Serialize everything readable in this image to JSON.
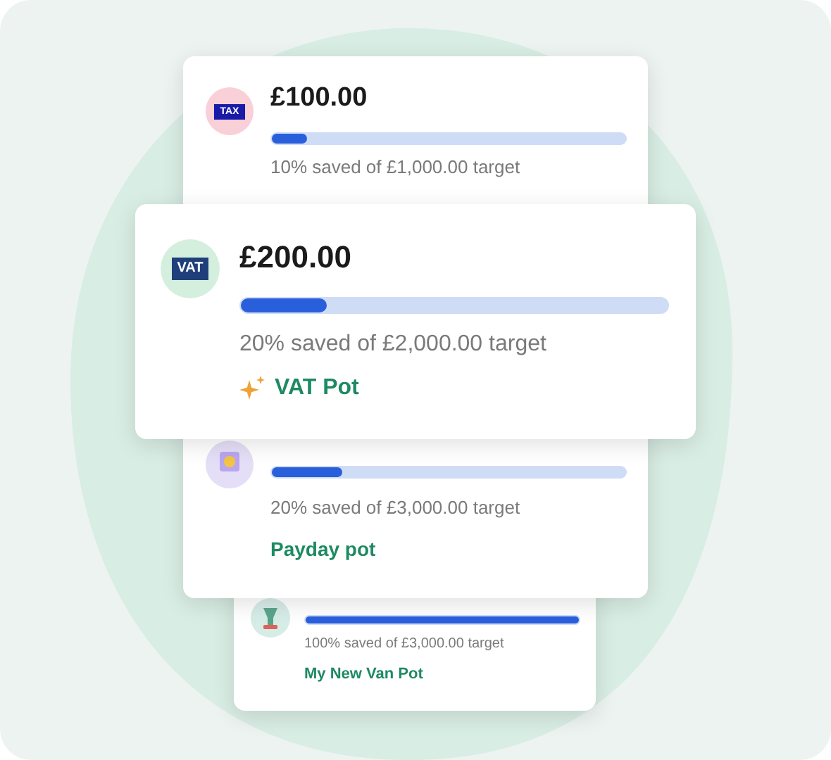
{
  "pots": [
    {
      "kind": "tax",
      "icon_label": "TAX",
      "amount": "£100.00",
      "level": 0.1,
      "progress": "10% saved of £1,000.00 target"
    },
    {
      "kind": "vat",
      "icon_label": "VAT",
      "amount": "£200.00",
      "level": 0.2,
      "progress": "20% saved of £2,000.00 target",
      "name": "VAT Pot",
      "sparkle": true
    },
    {
      "kind": "coin",
      "level": 0.2,
      "progress": "20% saved of £3,000.00 target",
      "name": "Payday pot"
    },
    {
      "kind": "van",
      "level": 1.0,
      "progress": "100% saved of £3,000.00 target",
      "name": "My New Van Pot"
    }
  ]
}
